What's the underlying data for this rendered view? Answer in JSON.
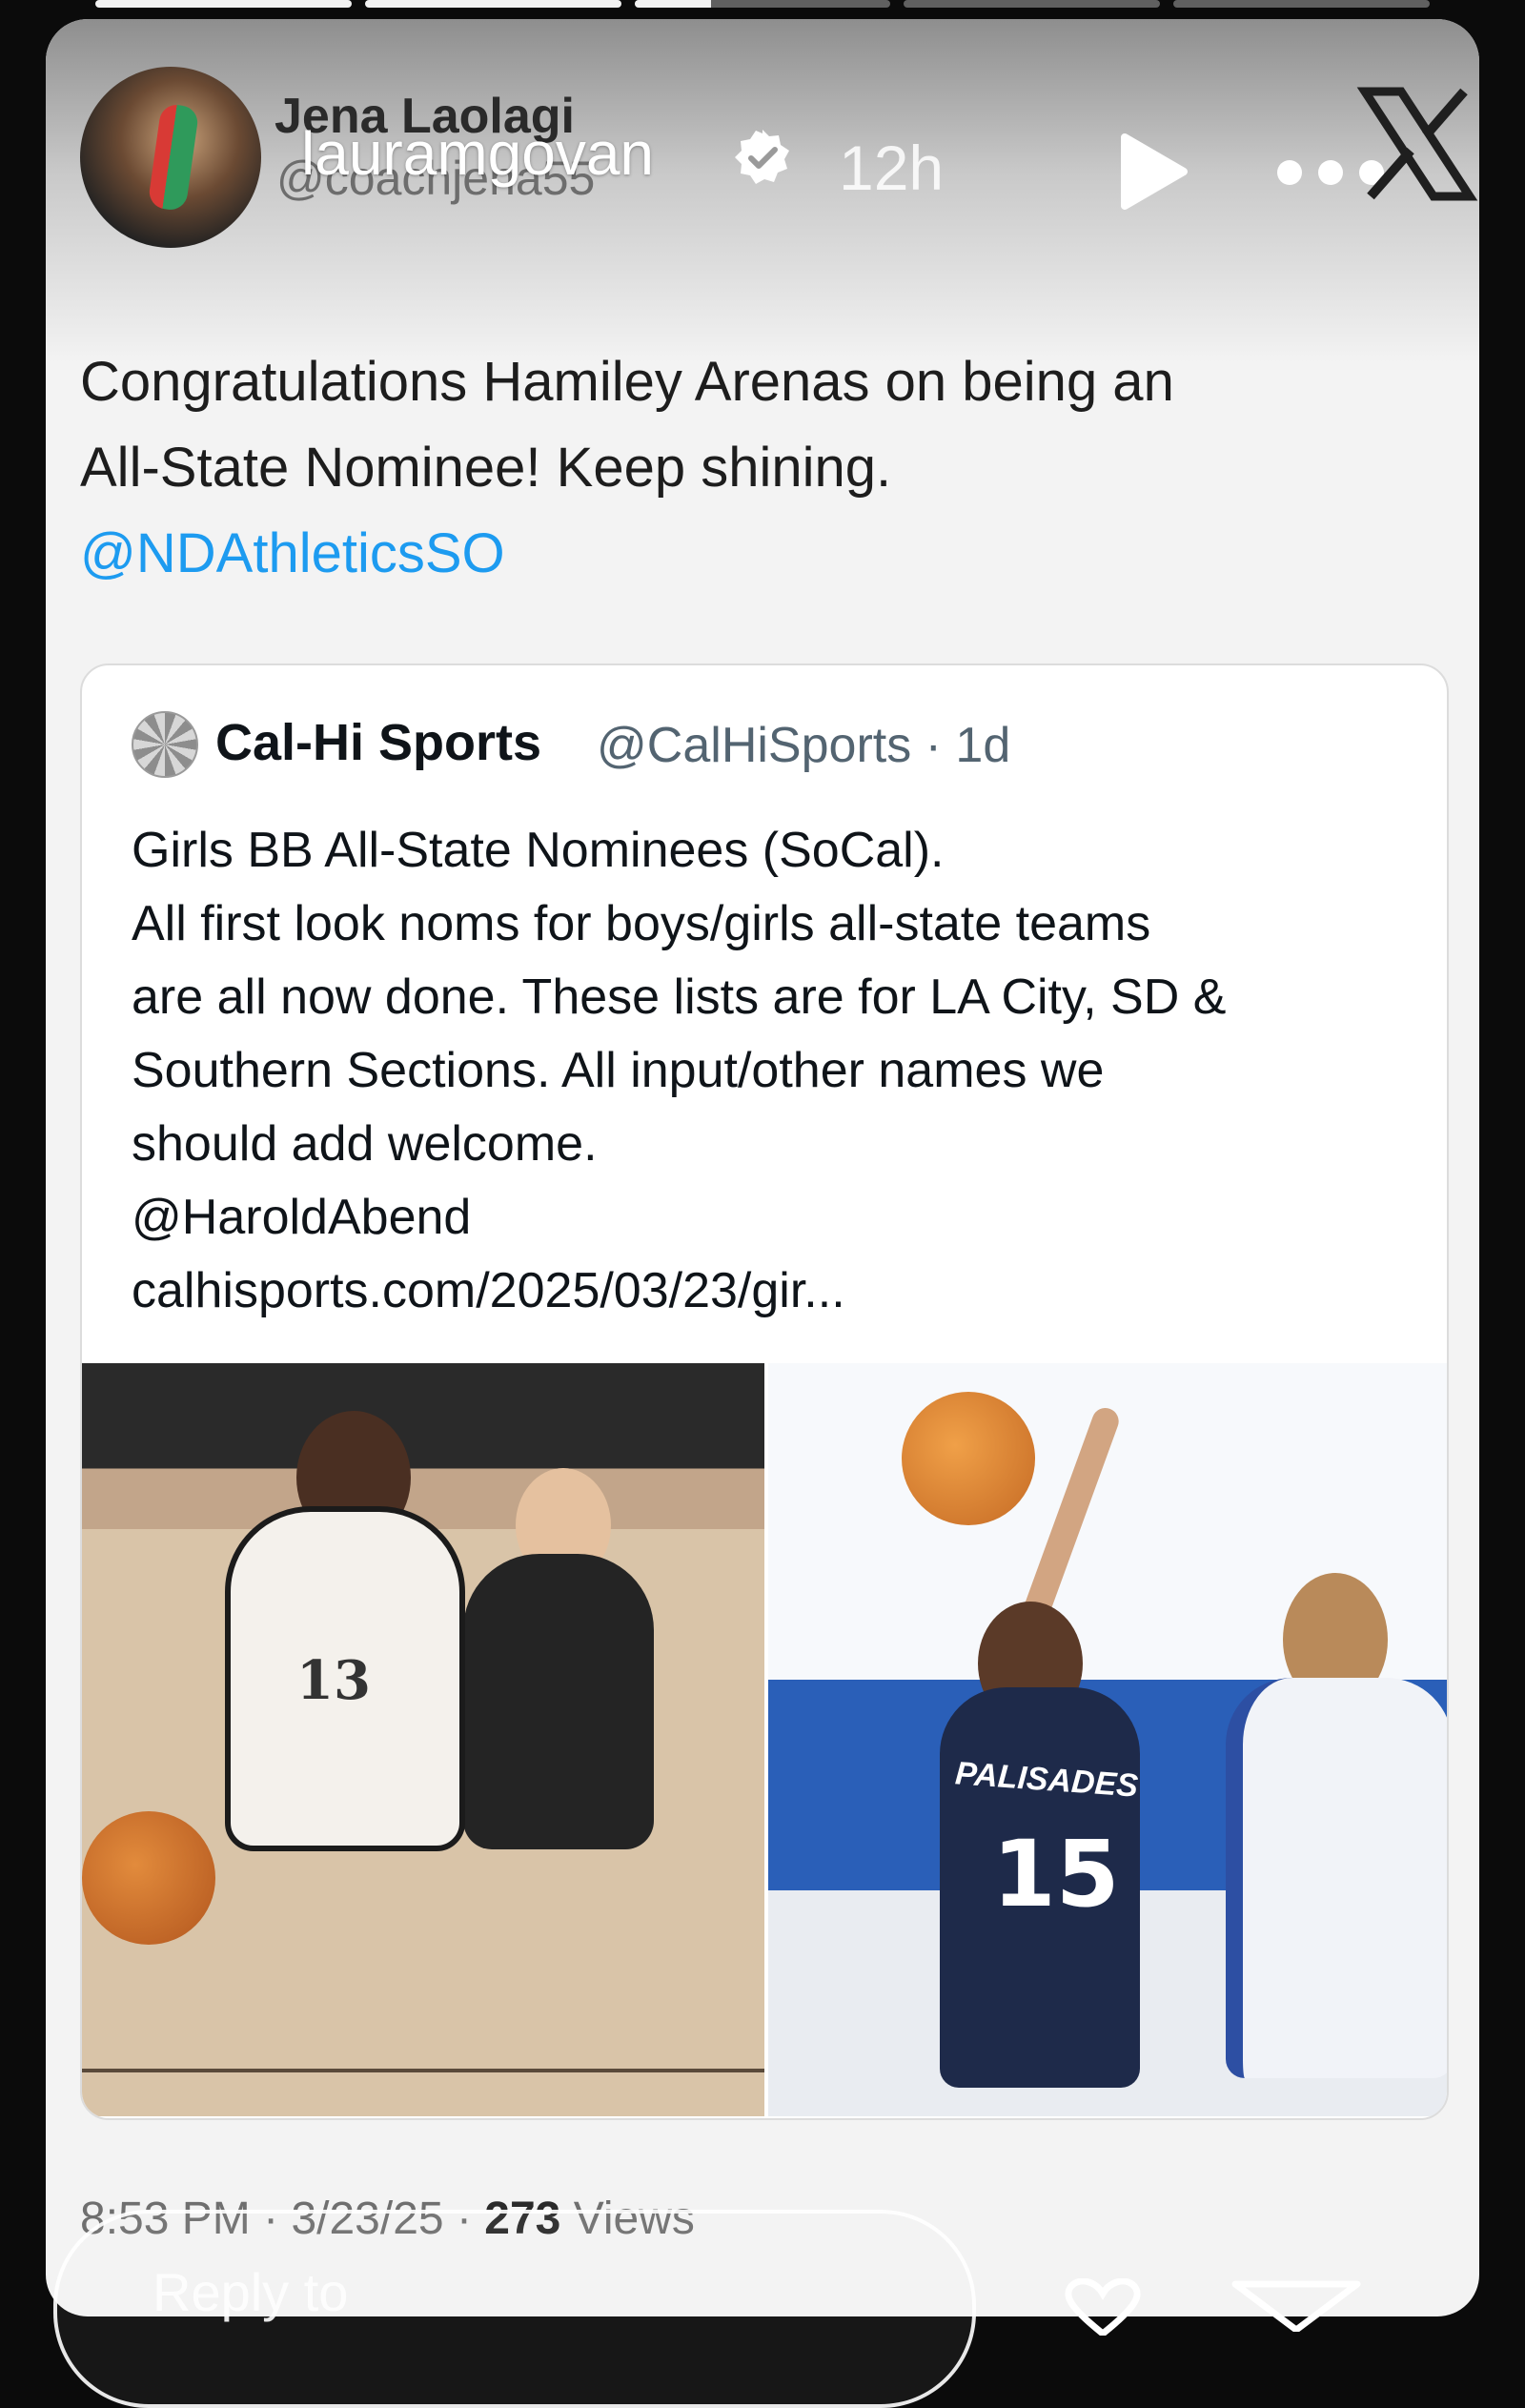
{
  "story": {
    "username": "lauramgovan",
    "time": "12h",
    "progress": [
      1.0,
      1.0,
      0.3,
      0.0,
      0.0
    ]
  },
  "tweet": {
    "author_name": "Jena Laolagi",
    "author_handle": "@coachjena55",
    "text_lines": [
      "Congratulations Hamiley Arenas on being an",
      "All-State Nominee! Keep shining."
    ],
    "mention": "@NDAthleticsSO",
    "time": "8:53 PM",
    "date": "3/23/25",
    "views_count": "273",
    "views_label": "Views"
  },
  "quote": {
    "name": "Cal-Hi Sports",
    "handle_time": "@CalHiSports · 1d",
    "lines": [
      "Girls BB All-State Nominees (SoCal).",
      "All first look noms for boys/girls all-state teams",
      "are all now done. These lists are for LA City, SD &",
      "Southern Sections. All input/other names we",
      "should add welcome.",
      "@HaroldAbend",
      "calhisports.com/2025/03/23/gir..."
    ],
    "left_jersey_number": "13",
    "right_jersey_text": "PALISADES",
    "right_jersey_number": "15"
  },
  "footer": {
    "reply_label": "Reply to"
  },
  "icons": {
    "verified": "verified-icon",
    "play": "play-icon",
    "more": "more-icon",
    "x_logo": "x-logo-icon",
    "heart": "heart-icon",
    "send": "send-icon"
  }
}
